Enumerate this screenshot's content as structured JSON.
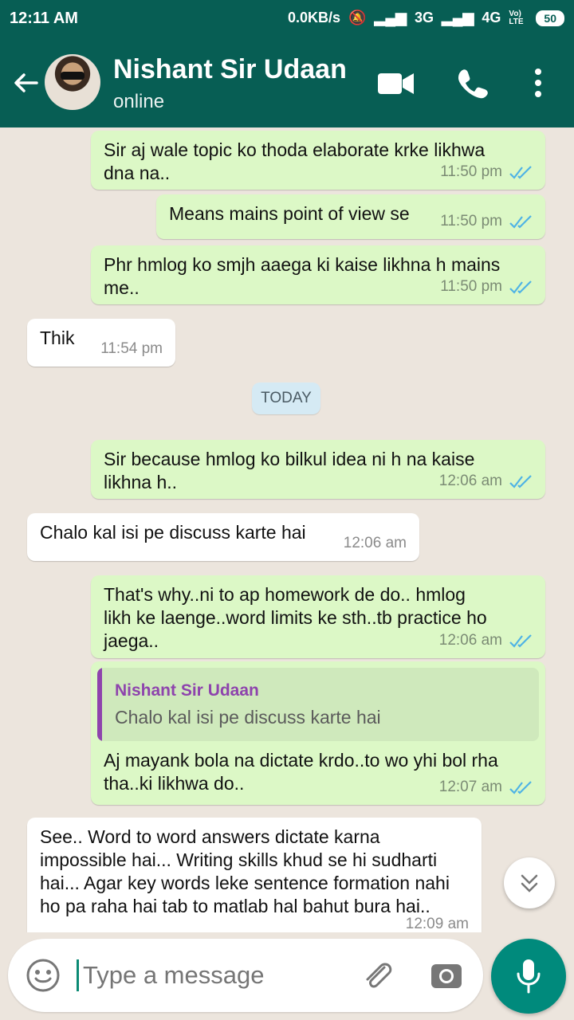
{
  "status": {
    "time": "12:11 AM",
    "speed": "0.0KB/s",
    "network1": "3G",
    "network2": "4G",
    "volte": "Vo) LTE",
    "battery": "50"
  },
  "header": {
    "name": "Nishant Sir Udaan",
    "status": "online"
  },
  "messages": [
    {
      "text": "Sir aj wale topic ko thoda elaborate krke likhwa\ndna na..",
      "time": "11:50 pm"
    },
    {
      "text": "Means mains point of view se",
      "time": "11:50 pm"
    },
    {
      "text": "Phr hmlog ko smjh aaega ki kaise likhna h mains\nme..",
      "time": "11:50 pm"
    },
    {
      "text": "Thik",
      "time": "11:54 pm"
    },
    {
      "text": "Sir because hmlog ko bilkul idea ni h na kaise\nlikhna h..",
      "time": "12:06 am"
    },
    {
      "text": "Chalo kal isi pe discuss karte hai",
      "time": "12:06 am"
    },
    {
      "text": "That's why..ni to ap homework de do.. hmlog\nlikh ke laenge..word limits ke sth..tb practice ho\njaega..",
      "time": "12:06 am"
    },
    {
      "text": "Aj mayank bola na dictate krdo..to wo yhi bol rha\ntha..ki likhwa do..",
      "time": "12:07 am"
    },
    {
      "text": "See.. Word to word answers dictate karna\nimpossible hai... Writing skills khud se hi sudharti\nhai... Agar key words leke sentence formation nahi\nho pa raha hai tab to matlab hal bahut bura hai..",
      "time": "12:09 am"
    }
  ],
  "date_chip": "TODAY",
  "reply": {
    "name": "Nishant Sir Udaan",
    "text": "Chalo kal isi pe discuss karte hai"
  },
  "composer": {
    "placeholder": "Type a message"
  },
  "colors": {
    "header": "#075e54",
    "outgoing": "#dcf8c6",
    "incoming": "#ffffff",
    "chat_bg": "#ece5dd",
    "mic": "#008a7c"
  },
  "icons": [
    "back-arrow-icon",
    "video-call-icon",
    "voice-call-icon",
    "more-options-icon",
    "emoji-icon",
    "paperclip-icon",
    "camera-icon",
    "mic-icon",
    "chevron-down-icon",
    "double-check-icon"
  ]
}
